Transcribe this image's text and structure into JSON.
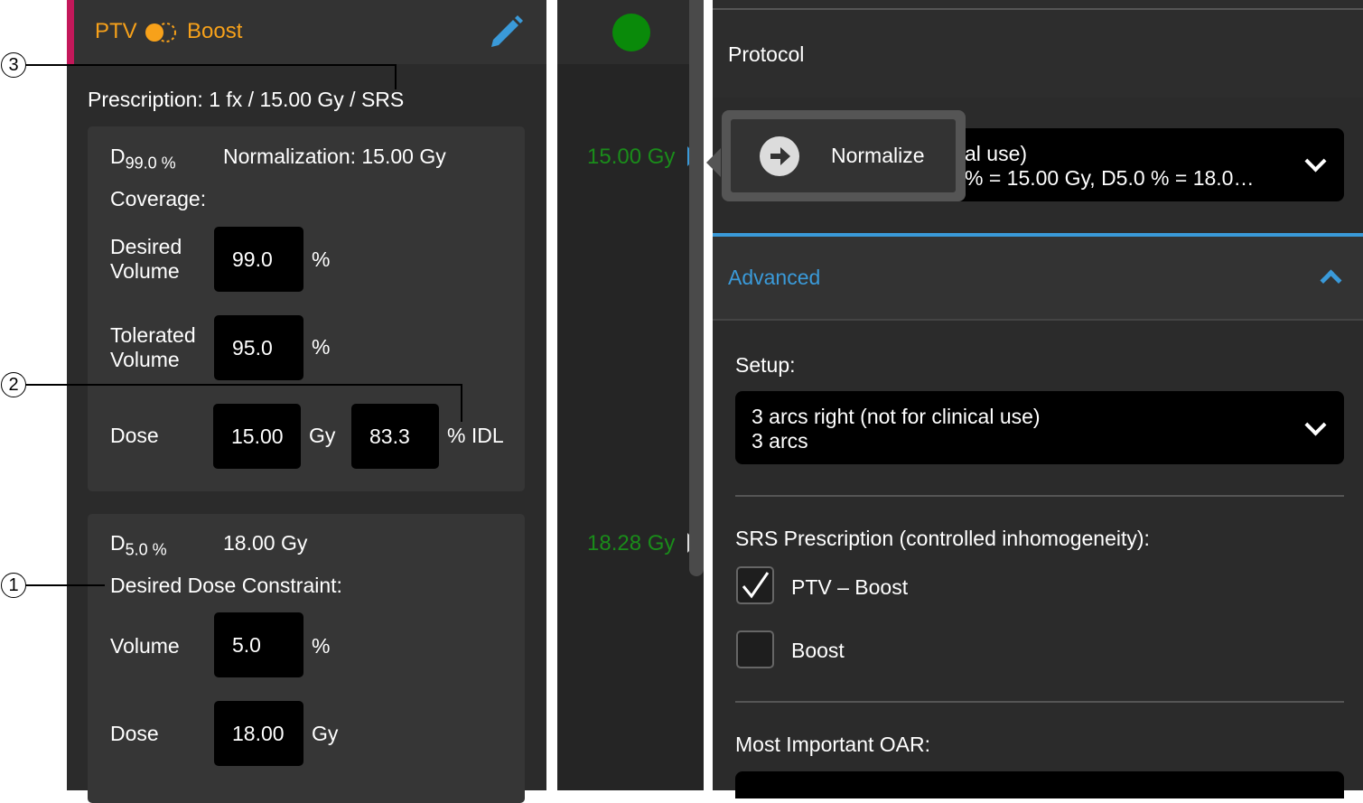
{
  "callouts": [
    "1",
    "2",
    "3"
  ],
  "left": {
    "structure": {
      "prefix": "PTV",
      "name": "Boost"
    },
    "prescription": "Prescription: 1 fx / 15.00 Gy / SRS",
    "d99": {
      "label_main": "D",
      "label_sub": "99.0 %",
      "normalization": "Normalization: 15.00 Gy",
      "coverage": "Coverage:",
      "desired_volume_label": "Desired Volume",
      "desired_volume_value": "99.0",
      "tolerated_volume_label": "Tolerated Volume",
      "tolerated_volume_value": "95.0",
      "percent_unit": "%",
      "dose_label": "Dose",
      "dose_value": "15.00",
      "gy_unit": "Gy",
      "idl_value": "83.3",
      "idl_unit": "% IDL"
    },
    "d5": {
      "label_main": "D",
      "label_sub": "5.0 %",
      "dose": "18.00 Gy",
      "constraint": "Desired Dose Constraint:",
      "volume_label": "Volume",
      "volume_value": "5.0",
      "percent_unit": "%",
      "dose_label": "Dose",
      "dose_value": "18.00",
      "gy_unit": "Gy"
    }
  },
  "middle": {
    "status_color": "#0a8a0a",
    "value_1": "15.00 Gy",
    "value_2": "18.28 Gy"
  },
  "right": {
    "protocol_title": "Protocol",
    "protocol_line1": "al use)",
    "protocol_line2": "% = 15.00 Gy, D5.0 % = 18.0…",
    "normalize_button": "Normalize",
    "advanced_label": "Advanced",
    "setup_label": "Setup:",
    "setup_line1": "3 arcs right (not for clinical use)",
    "setup_line2": "3 arcs",
    "srs_label": "SRS Prescription (controlled inhomogeneity):",
    "checkboxes": [
      {
        "label": "PTV – Boost",
        "checked": true
      },
      {
        "label": "Boost",
        "checked": false
      }
    ],
    "oar_label": "Most Important OAR:"
  },
  "colors": {
    "accent_orange": "#f7a11a",
    "accent_blue": "#3a9ad9",
    "magenta": "#c3185a",
    "green": "#1a8c1a"
  }
}
